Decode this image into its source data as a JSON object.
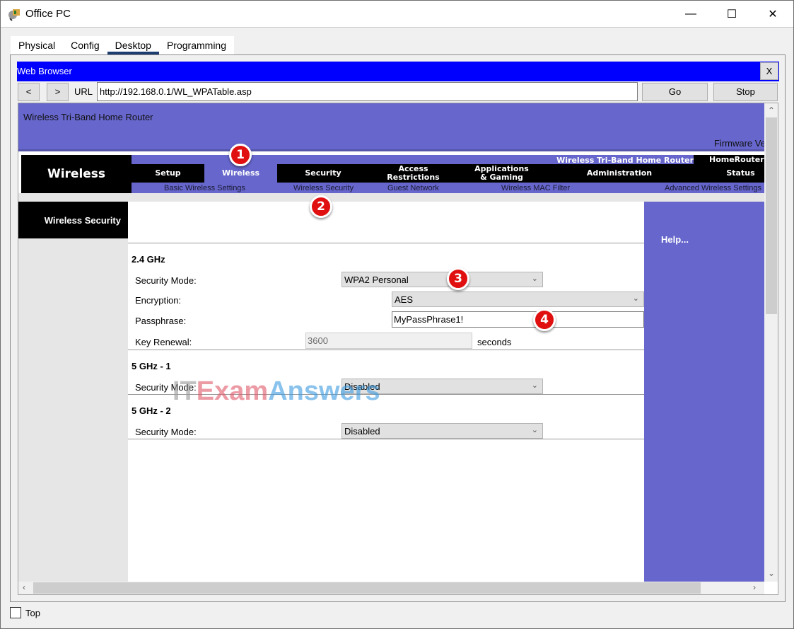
{
  "window": {
    "title": "Office PC",
    "controls": {
      "minimize": "—",
      "maximize": "☐",
      "close": "✕"
    }
  },
  "tabs": [
    {
      "label": "Physical",
      "active": false
    },
    {
      "label": "Config",
      "active": false
    },
    {
      "label": "Desktop",
      "active": true
    },
    {
      "label": "Programming",
      "active": false
    }
  ],
  "browser": {
    "title": "Web Browser",
    "close_label": "X",
    "back_label": "<",
    "forward_label": ">",
    "url_label": "URL",
    "url": "http://192.168.0.1/WL_WPATable.asp",
    "go_label": "Go",
    "stop_label": "Stop"
  },
  "router": {
    "header_title": "Wireless Tri-Band Home Router",
    "firmware_label": "Firmware Ve",
    "section_brand": "Wireless",
    "model_name": "Wireless Tri-Band Home Router",
    "host_name": "HomeRouter",
    "nav": [
      {
        "label": "Setup",
        "active": false
      },
      {
        "label": "Wireless",
        "active": true
      },
      {
        "label": "Security",
        "active": false
      },
      {
        "label": "Access\nRestrictions",
        "active": false
      },
      {
        "label": "Applications\n& Gaming",
        "active": false
      },
      {
        "label": "Administration",
        "active": false
      },
      {
        "label": "Status",
        "active": false
      }
    ],
    "subnav": [
      "Basic Wireless Settings",
      "Wireless Security",
      "Guest Network",
      "Wireless MAC Filter",
      "Advanced Wireless Settings"
    ],
    "side_title": "Wireless Security",
    "help_label": "Help...",
    "bands": {
      "b24": {
        "title": "2.4 GHz",
        "security_mode_label": "Security Mode:",
        "security_mode_value": "WPA2 Personal",
        "encryption_label": "Encryption:",
        "encryption_value": "AES",
        "passphrase_label": "Passphrase:",
        "passphrase_value": "MyPassPhrase1!",
        "key_renewal_label": "Key Renewal:",
        "key_renewal_value": "3600",
        "key_renewal_unit": "seconds"
      },
      "b5_1": {
        "title": "5 GHz - 1",
        "security_mode_label": "Security Mode:",
        "security_mode_value": "Disabled"
      },
      "b5_2": {
        "title": "5 GHz - 2",
        "security_mode_label": "Security Mode:",
        "security_mode_value": "Disabled"
      }
    }
  },
  "annotations": [
    "1",
    "2",
    "3",
    "4"
  ],
  "watermark": {
    "it": "IT",
    "exam": "Exam",
    "answers": "Answers"
  },
  "footer": {
    "top_label": "Top",
    "top_checked": false
  },
  "colors": {
    "router_purple": "#6666cc",
    "browser_bar_blue": "#0000ff",
    "badge_red": "#e01010",
    "active_tab_underline": "#1c3d6e"
  }
}
